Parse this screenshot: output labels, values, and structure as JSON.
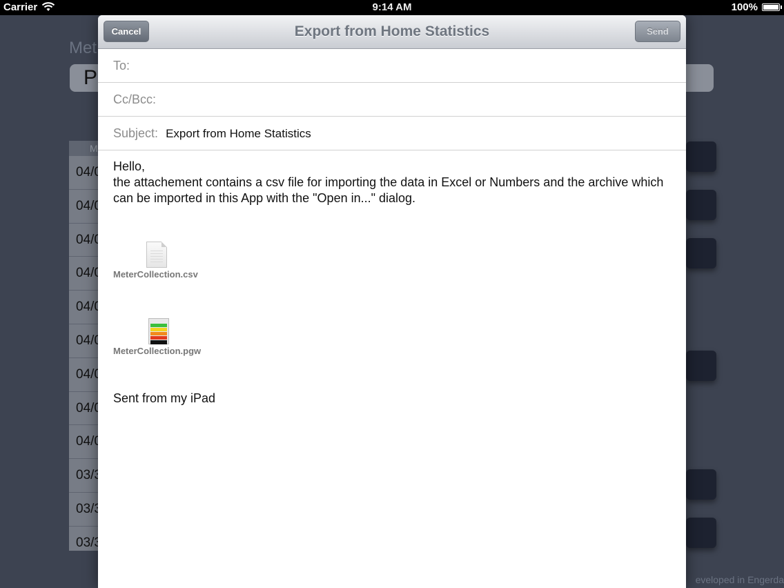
{
  "status_bar": {
    "carrier": "Carrier",
    "time": "9:14 AM",
    "battery": "100%"
  },
  "background_app": {
    "heading": "Met",
    "field_text": "P",
    "table_header": "M",
    "rows": [
      "04/0",
      "04/0",
      "04/0",
      "04/0",
      "04/0",
      "04/0",
      "04/0",
      "04/0",
      "04/0",
      "03/3",
      "03/3",
      "03/3"
    ],
    "footer": "eveloped in Engerda"
  },
  "composer": {
    "title": "Export from Home Statistics",
    "cancel_label": "Cancel",
    "send_label": "Send",
    "to_label": "To:",
    "to_value": "",
    "cc_label": "Cc/Bcc:",
    "cc_value": "",
    "subject_label": "Subject:",
    "subject_value": "Export from Home Statistics",
    "body_line1": "Hello,",
    "body_line2": "the attachement contains a csv file for importing the data in Excel or Numbers and the archive which can be imported in this App with the \"Open in...\" dialog.",
    "attachments": [
      {
        "name": "MeterCollection.csv",
        "icon": "document-icon"
      },
      {
        "name": "MeterCollection.pgw",
        "icon": "archive-icon"
      }
    ],
    "signature": "Sent from my iPad"
  }
}
